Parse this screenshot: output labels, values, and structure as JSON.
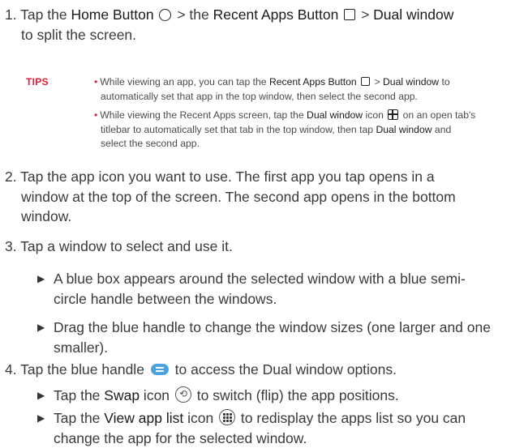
{
  "step1": {
    "num": "1.",
    "t1": "Tap the ",
    "home_button": "Home Button",
    "t2": " > the ",
    "recent_apps_button": "Recent Apps Button",
    "t3": " > ",
    "dual_window": "Dual window",
    "t4": "to split the screen."
  },
  "tips": {
    "label": "TIPS",
    "tip1": {
      "t1": "While viewing an app, you can tap the ",
      "recent_apps_button": "Recent Apps Button",
      "t2": " > ",
      "dual_window": "Dual window",
      "t3": " to",
      "t4": "automatically set that app in the top window, then select the second app."
    },
    "tip2": {
      "t1": "While viewing the Recent Apps screen, tap the ",
      "dual_window": "Dual window",
      "t2": " icon ",
      "t3": " on an open tab's",
      "t4": "titlebar to automatically set that tab in the top window, then tap ",
      "dual_window2": "Dual window",
      "t5": " and",
      "t6": "select the second app."
    }
  },
  "step2": {
    "num": "2.",
    "line1": "Tap the app icon you want to use. The first app you tap opens in a",
    "line2": "window at the top of the screen. The second app opens in the bottom",
    "line3": "window."
  },
  "step3": {
    "num": "3.",
    "text": "Tap a window to select and use it.",
    "sub1_line1": "A blue box appears around the selected window with a blue semi-",
    "sub1_line2": "circle handle between the windows.",
    "sub2_line1": "Drag the blue handle to change the window sizes (one larger and one",
    "sub2_line2": "smaller)."
  },
  "step4": {
    "num": "4.",
    "t1": "Tap the blue handle ",
    "t2": " to access the Dual window options.",
    "sub1_t1": "Tap the ",
    "swap": "Swap",
    "sub1_t2": " icon ",
    "sub1_t3": " to switch (flip) the app positions.",
    "sub2_t1": "Tap the ",
    "view_app_list": "View app list",
    "sub2_t2": " icon ",
    "sub2_t3": " to redisplay the apps list so you can",
    "sub2_line2": "change the app for the selected window."
  },
  "icons": {
    "home": "home-button-icon",
    "recent": "recent-apps-icon",
    "dual": "dual-window-icon",
    "handle": "blue-handle-icon",
    "swap": "swap-icon",
    "applist": "view-app-list-icon"
  },
  "colors": {
    "tips": "#d8203a",
    "handle": "#4aa3df",
    "text": "#3a3a3a"
  }
}
